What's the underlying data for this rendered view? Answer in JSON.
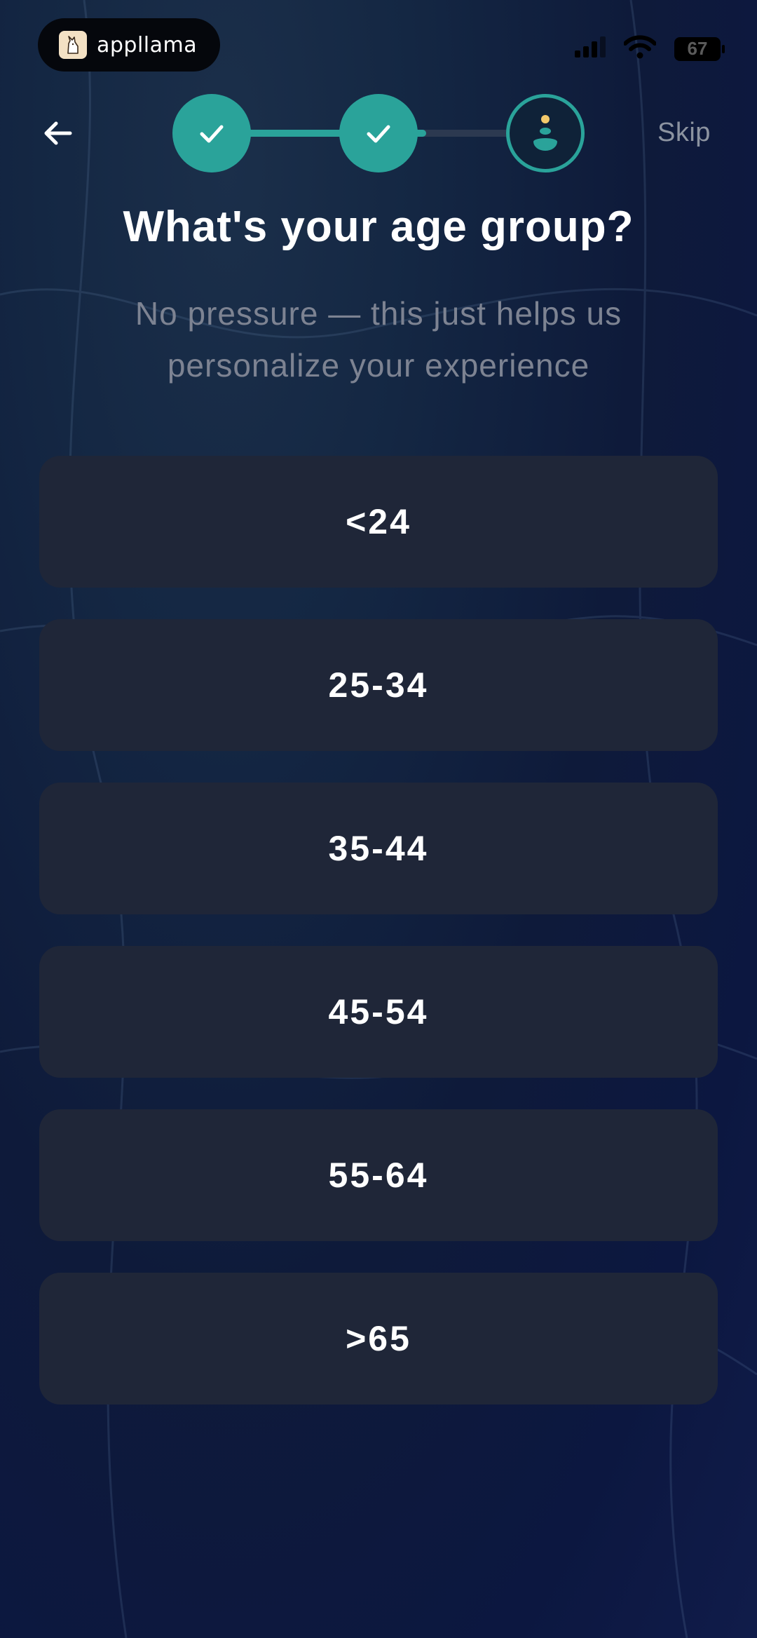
{
  "status_bar": {
    "app_name": "appllama",
    "battery_level": "67"
  },
  "header": {
    "skip_label": "Skip",
    "steps": [
      {
        "state": "done",
        "icon": "check-icon"
      },
      {
        "state": "done",
        "icon": "check-icon"
      },
      {
        "state": "current",
        "icon": "stacked-stones-icon"
      }
    ]
  },
  "question": {
    "title": "What's your age group?",
    "subtitle": "No pressure — this just helps us personalize your experience"
  },
  "options": [
    {
      "label": "<24"
    },
    {
      "label": "25-34"
    },
    {
      "label": "35-44"
    },
    {
      "label": "45-54"
    },
    {
      "label": "55-64"
    },
    {
      "label": ">65"
    }
  ],
  "colors": {
    "accent": "#2aa39a",
    "option_bg": "#1f2638",
    "muted_text": "#7d8392",
    "skip_text": "#8c93a0"
  }
}
